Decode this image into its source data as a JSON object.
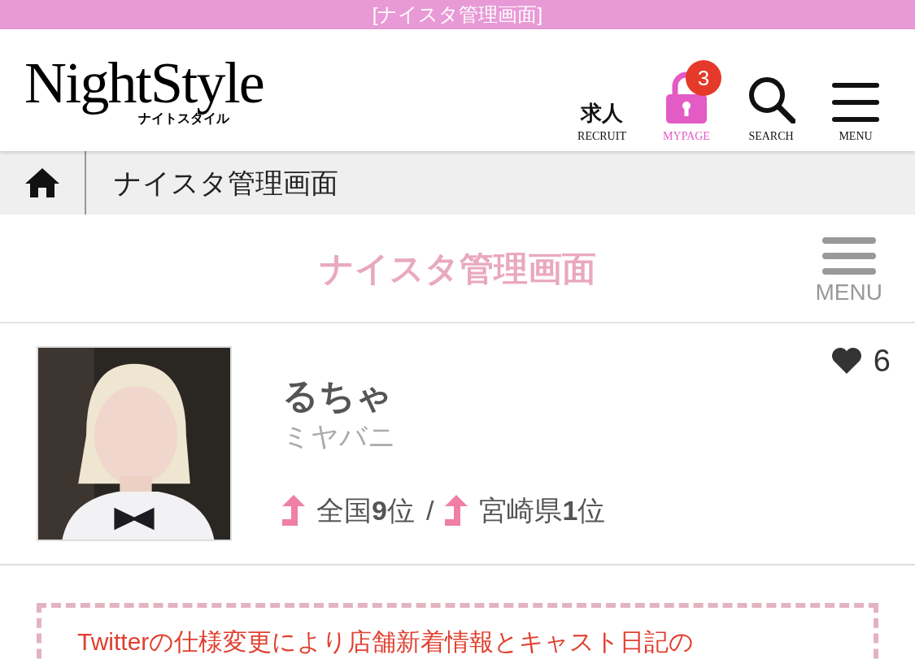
{
  "top_bar": {
    "title": "[ナイスタ管理画面]"
  },
  "header": {
    "logo": {
      "main": "NightStyle",
      "sub": "ナイトスタイル"
    },
    "nav": [
      {
        "kind": "recruit",
        "mark": "求人",
        "label": "RECRUIT",
        "selected": false
      },
      {
        "kind": "mypage",
        "label": "MYPAGE",
        "badge": "3",
        "selected": true
      },
      {
        "kind": "search",
        "label": "SEARCH",
        "selected": false
      },
      {
        "kind": "menu",
        "label": "MENU",
        "selected": false
      }
    ]
  },
  "breadcrumb": {
    "current": "ナイスタ管理画面"
  },
  "page_title": {
    "title": "ナイスタ管理画面",
    "menu_label": "MENU"
  },
  "profile": {
    "name": "るちゃ",
    "shop": "ミヤバニ",
    "likes": "6",
    "ranks": [
      {
        "text": "全国**9**位"
      },
      {
        "text": "宮崎県**1**位"
      }
    ],
    "separator": "/"
  },
  "notice": {
    "text": "Twitterの仕様変更により店舗新着情報とキャスト日記の"
  }
}
